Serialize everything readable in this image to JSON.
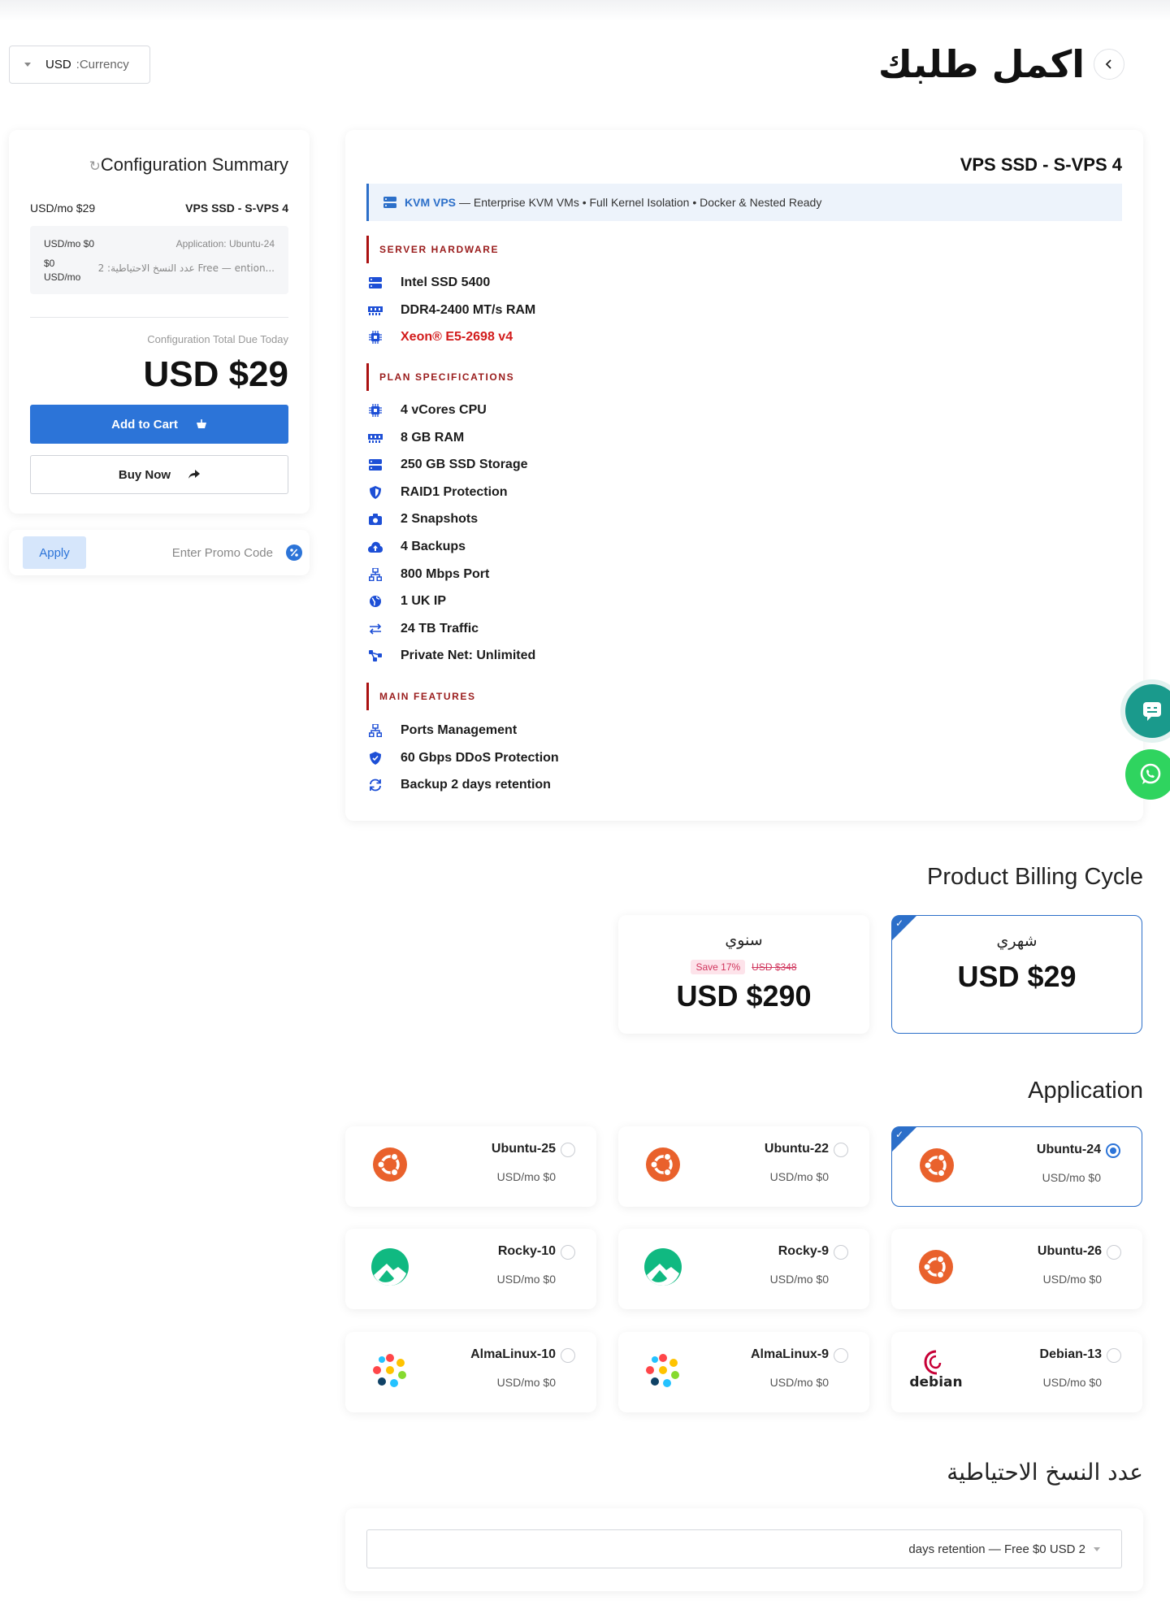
{
  "header": {
    "title": "اكمل طلبك",
    "currency_value": "USD",
    "currency_label": ":Currency"
  },
  "summary": {
    "title": "Configuration Summary",
    "price_line": "USD/mo $29",
    "product": "VPS SSD - S-VPS 4",
    "addon_1_price": "USD/mo $0",
    "addon_1_label": "Application: Ubuntu-24",
    "addon_2_price_line1": "$0",
    "addon_2_price_line2": "USD/mo",
    "addon_2_label": "عدد النسخ الاحتياطية: 2 Free — ention...",
    "total_label": "Configuration Total Due Today",
    "total_price": "USD $29",
    "add_to_cart": "Add to Cart",
    "buy_now": "Buy Now"
  },
  "promo": {
    "apply": "Apply",
    "placeholder": "Enter Promo Code"
  },
  "product": {
    "name": "VPS SSD - S-VPS 4",
    "kvm_label": "KVM VPS",
    "kvm_desc": "— Enterprise KVM VMs • Full Kernel Isolation • Docker & Nested Ready",
    "sections": {
      "hardware": "SERVER HARDWARE",
      "specs": "PLAN SPECIFICATIONS",
      "features": "MAIN FEATURES"
    },
    "hardware": [
      {
        "text": "Intel SSD 5400",
        "icon": "server-icon"
      },
      {
        "text": "DDR4-2400 MT/s RAM",
        "icon": "memory-icon"
      },
      {
        "text": "Xeon® E5-2698 v4",
        "icon": "cpu-icon"
      }
    ],
    "specs": [
      {
        "text": "4 vCores CPU",
        "icon": "cpu-icon"
      },
      {
        "text": "8 GB RAM",
        "icon": "memory-icon"
      },
      {
        "text": "250 GB SSD Storage",
        "icon": "server-icon"
      },
      {
        "text": "RAID1 Protection",
        "icon": "shield-icon"
      },
      {
        "text": "2 Snapshots",
        "icon": "camera-icon"
      },
      {
        "text": "4 Backups",
        "icon": "cloud-upload-icon"
      },
      {
        "text": "800 Mbps Port",
        "icon": "network-icon"
      },
      {
        "text": "1 UK IP",
        "icon": "globe-icon"
      },
      {
        "text": "24 TB Traffic",
        "icon": "arrows-icon"
      },
      {
        "text": "Private Net: Unlimited",
        "icon": "share-nodes-icon"
      }
    ],
    "features": [
      {
        "text": "Ports Management",
        "icon": "network-icon"
      },
      {
        "text": "60 Gbps DDoS Protection",
        "icon": "shield-check-icon"
      },
      {
        "text": "Backup 2 days retention",
        "icon": "sync-icon"
      }
    ]
  },
  "billing": {
    "title": "Product Billing Cycle",
    "monthly": {
      "label": "شهري",
      "price": "USD $29"
    },
    "annual": {
      "label": "سنوي",
      "save": "Save 17%",
      "old": "USD $348",
      "price": "USD $290"
    }
  },
  "application": {
    "title": "Application",
    "items": [
      {
        "name": "Ubuntu-25",
        "price": "USD/mo $0",
        "logo": "ubuntu-icon"
      },
      {
        "name": "Ubuntu-22",
        "price": "USD/mo $0",
        "logo": "ubuntu-icon"
      },
      {
        "name": "Ubuntu-24",
        "price": "USD/mo $0",
        "logo": "ubuntu-icon",
        "selected": true
      },
      {
        "name": "Rocky-10",
        "price": "USD/mo $0",
        "logo": "rocky-icon"
      },
      {
        "name": "Rocky-9",
        "price": "USD/mo $0",
        "logo": "rocky-icon"
      },
      {
        "name": "Ubuntu-26",
        "price": "USD/mo $0",
        "logo": "ubuntu-icon"
      },
      {
        "name": "AlmaLinux-10",
        "price": "USD/mo $0",
        "logo": "almalinux-icon"
      },
      {
        "name": "AlmaLinux-9",
        "price": "USD/mo $0",
        "logo": "almalinux-icon"
      },
      {
        "name": "Debian-13",
        "price": "USD/mo $0",
        "logo": "debian-icon",
        "logo_text": "debian"
      }
    ]
  },
  "backups": {
    "title": "عدد النسخ الاحتياطية",
    "selected": "days retention — Free $0 USD 2"
  },
  "colors": {
    "accent": "#2c74d8",
    "section_red": "#9a1c1c",
    "ubuntu": "#e9612c",
    "rocky": "#10b981",
    "whatsapp": "#2fd45f"
  }
}
